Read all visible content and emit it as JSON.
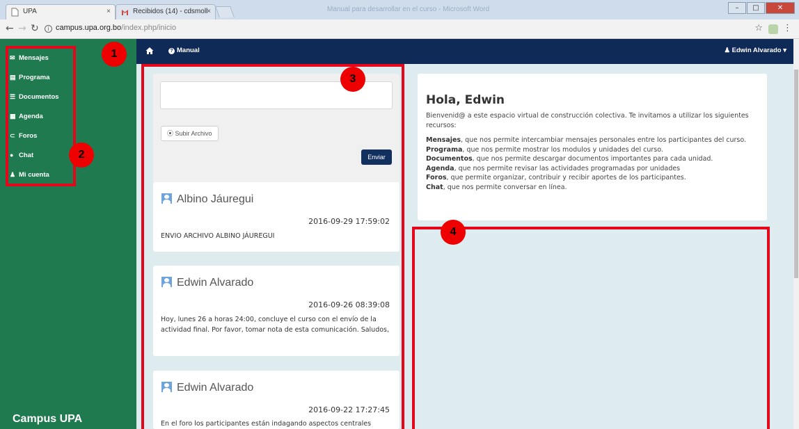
{
  "browser": {
    "tabs": [
      {
        "label": "UPA",
        "active": true
      },
      {
        "label": "Recibidos (14) - cdsmoll",
        "active": false
      }
    ],
    "window_title": "Manual para desarrollar en el curso - Microsoft Word",
    "url_host": "campus.upa.org.bo",
    "url_path": "/index.php/inicio"
  },
  "sidebar": {
    "items": [
      {
        "label": "Mensajes",
        "icon": "envelope-icon"
      },
      {
        "label": "Programa",
        "icon": "list-icon"
      },
      {
        "label": "Documentos",
        "icon": "document-icon"
      },
      {
        "label": "Agenda",
        "icon": "calendar-icon"
      },
      {
        "label": "Foros",
        "icon": "forum-icon"
      },
      {
        "label": "Chat",
        "icon": "chat-icon"
      },
      {
        "label": "Mi cuenta",
        "icon": "user-icon"
      }
    ],
    "brand": "Campus UPA"
  },
  "topnav": {
    "manual": "Manual",
    "user": "Edwin Alvarado"
  },
  "composer": {
    "upload": "Subir Archivo",
    "send": "Enviar"
  },
  "messages": [
    {
      "author": "Albino Jáuregui",
      "date": "2016-09-29 17:59:02",
      "body": "ENVIO ARCHIVO ALBINO JÁUREGUI"
    },
    {
      "author": "Edwin Alvarado",
      "date": "2016-09-26 08:39:08",
      "body": "Hoy, lunes 26 a horas 24:00, concluye el curso con el envío de la actividad final. Por favor, tomar nota de esta comunicación. Saludos,"
    },
    {
      "author": "Edwin Alvarado",
      "date": "2016-09-22 17:27:45",
      "body": "En el foro los participantes están indagando aspectos centrales"
    }
  ],
  "welcome": {
    "title": "Hola, Edwin",
    "intro": "Bienvenid@ a este espacio virtual de construcción colectiva. Te invitamos a utilizar los siguientes recursos:",
    "resources": [
      {
        "name": "Mensajes",
        "text": ", que nos permite intercambiar mensajes personales entre los participantes del curso."
      },
      {
        "name": "Programa",
        "text": ", que nos permite mostrar los modulos y unidades del curso."
      },
      {
        "name": "Documentos",
        "text": ", que nos permite descargar documentos importantes para cada unidad."
      },
      {
        "name": "Agenda",
        "text": ", que nos permite revisar las actividades programadas por unidades"
      },
      {
        "name": "Foros",
        "text": ", que permite organizar, contribuir y recibir aportes de los participantes."
      },
      {
        "name": "Chat",
        "text": ", que nos permite conversar en línea."
      }
    ]
  },
  "annotations": [
    "1",
    "2",
    "3",
    "4"
  ],
  "colors": {
    "sidebar": "#1f7a4f",
    "topnav": "#0f2a57",
    "content_bg": "#deebef",
    "annotation": "#e4061a"
  }
}
